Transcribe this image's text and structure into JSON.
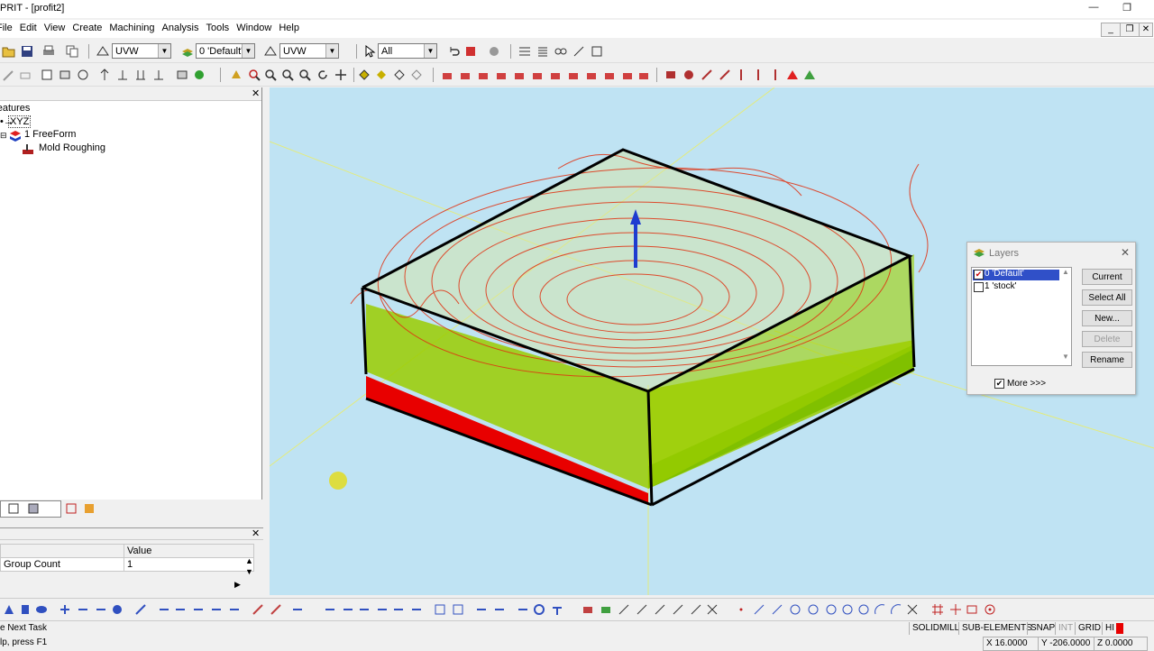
{
  "window": {
    "title": "PRIT - [profit2]",
    "minimize": "—",
    "restore": "❐"
  },
  "menu": [
    "File",
    "Edit",
    "View",
    "Create",
    "Machining",
    "Analysis",
    "Tools",
    "Window",
    "Help"
  ],
  "toolbar": {
    "workplane_combo": "UVW",
    "layer_combo": "0 'Default'",
    "workplane_combo2": "UVW",
    "filter_combo": "All"
  },
  "tree": {
    "header": "Features",
    "xyz": "XYZ",
    "item1": "1 FreeForm",
    "item2": "Mold Roughing"
  },
  "properties": {
    "header_value": "Value",
    "rows": [
      {
        "name": "Group Count",
        "value": "1"
      }
    ]
  },
  "layers_dialog": {
    "title": "Layers",
    "items": [
      {
        "label": "0 'Default'",
        "checked": true,
        "selected": true
      },
      {
        "label": "1 'stock'",
        "checked": false,
        "selected": false
      }
    ],
    "buttons": {
      "current": "Current",
      "select_all": "Select All",
      "new": "New...",
      "delete": "Delete",
      "rename": "Rename"
    },
    "more_label": "More >>>",
    "more_checked": true
  },
  "status": {
    "task": "e Next Task",
    "help": "lp, press F1",
    "modes": [
      "SOLIDMILL",
      "SUB-ELEMENTS",
      "SNAP",
      "INT",
      "GRID",
      "HI"
    ],
    "x": "X 16.0000",
    "y": "Y -206.0000",
    "z": "Z 0.0000"
  },
  "colors": {
    "viewport_bg": "#bfe3f3",
    "stock_red": "#e80000",
    "stock_green": "#88c800",
    "toolpath": "#e03010",
    "axis_blue": "#1e3cd0"
  }
}
